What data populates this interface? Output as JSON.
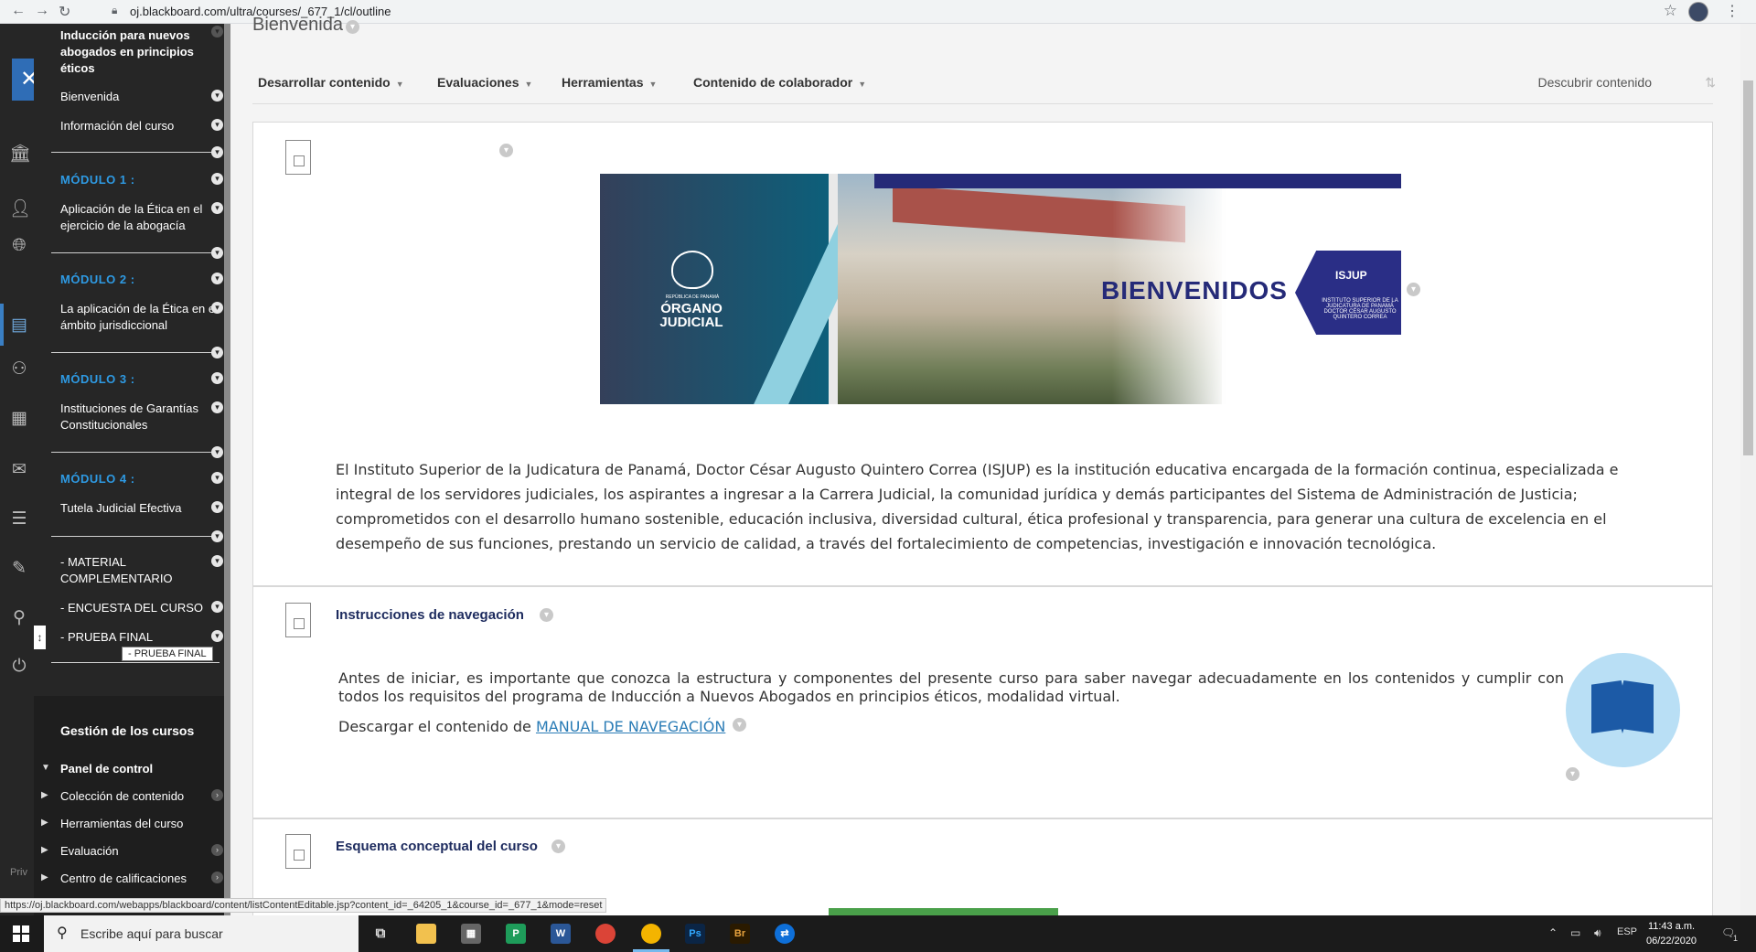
{
  "browser": {
    "url": "oj.blackboard.com/ultra/courses/_677_1/cl/outline"
  },
  "course_menu": {
    "title": "Inducción para nuevos abogados en principios éticos",
    "items": [
      {
        "label": "Bienvenida"
      },
      {
        "label": "Información del curso"
      },
      {
        "label": "MÓDULO 1 :"
      },
      {
        "label": "Aplicación de la Ética en el ejercicio de la abogacía"
      },
      {
        "label": "MÓDULO 2 :"
      },
      {
        "label": "La aplicación de la Ética en el ámbito jurisdiccional"
      },
      {
        "label": "MÓDULO 3 :"
      },
      {
        "label": "Instituciones de Garantías Constitucionales"
      },
      {
        "label": "MÓDULO 4 :"
      },
      {
        "label": "Tutela Judicial Efectiva"
      },
      {
        "label": "- MATERIAL COMPLEMENTARIO"
      },
      {
        "label": "- ENCUESTA DEL CURSO"
      },
      {
        "label": "- PRUEBA FINAL"
      }
    ],
    "tooltip": "- PRUEBA FINAL",
    "management_title": "Gestión de los cursos",
    "control_panel": "Panel de control",
    "control_items": [
      {
        "label": "Colección de contenido"
      },
      {
        "label": "Herramientas del curso"
      },
      {
        "label": "Evaluación"
      },
      {
        "label": "Centro de calificaciones"
      }
    ]
  },
  "rail": {
    "close_icon": "close-icon",
    "privacy_text": "Priv"
  },
  "page": {
    "title": "Bienvenida",
    "toolbar": [
      {
        "label": "Desarrollar contenido"
      },
      {
        "label": "Evaluaciones"
      },
      {
        "label": "Herramientas"
      },
      {
        "label": "Contenido de colaborador"
      }
    ],
    "discover": "Descubrir contenido"
  },
  "banner": {
    "welcome": "BIENVENIDOS",
    "logo_left": "ÓRGANO JUDICIAL",
    "logo_left_top": "REPÚBLICA DE PANAMÁ",
    "logo_right": "ISJUP",
    "logo_right_sub": "INSTITUTO SUPERIOR DE LA JUDICATURA DE PANAMÁ DOCTOR CÉSAR AUGUSTO QUINTERO CORREA"
  },
  "intro_text": "El Instituto Superior de la Judicatura de Panamá, Doctor César Augusto Quintero Correa (ISJUP) es la institución educativa encargada de la formación continua, especializada e integral de los servidores judiciales, los aspirantes a ingresar a la Carrera Judicial, la comunidad jurídica y demás participantes del Sistema de Administración de Justicia; comprometidos con el desarrollo humano sostenible, educación inclusiva, diversidad cultural, ética profesional y transparencia, para generar una cultura de excelencia en el desempeño de sus funciones, prestando un servicio de calidad, a través del fortalecimiento de competencias, investigación e innovación tecnológica.",
  "nav_item": {
    "title": "Instrucciones de navegación",
    "body": "Antes de iniciar, es importante que conozca la estructura y componentes del presente curso para saber navegar adecuadamente en los contenidos y cumplir con todos los requisitos del programa de Inducción a Nuevos Abogados en principios éticos, modalidad virtual.",
    "download_prefix": "Descargar el contenido de",
    "download_link": "MANUAL DE NAVEGACIÓN"
  },
  "schema_item": {
    "title": "Esquema conceptual del curso"
  },
  "status_url": "https://oj.blackboard.com/webapps/blackboard/content/listContentEditable.jsp?content_id=_64205_1&course_id=_677_1&mode=reset",
  "taskbar": {
    "search_placeholder": "Escribe aquí para buscar",
    "lang": "ESP",
    "time": "11:43 a.m.",
    "date": "06/22/2020",
    "notif_count": "1"
  }
}
